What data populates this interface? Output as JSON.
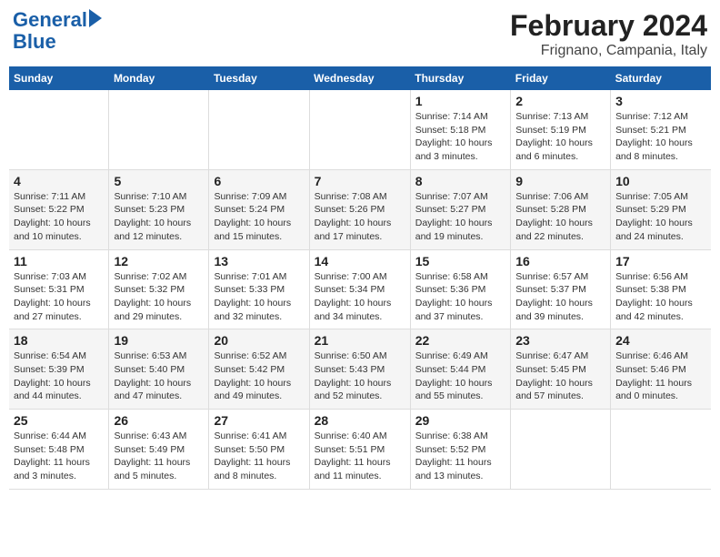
{
  "logo": {
    "line1": "General",
    "line2": "Blue"
  },
  "title": "February 2024",
  "subtitle": "Frignano, Campania, Italy",
  "headers": [
    "Sunday",
    "Monday",
    "Tuesday",
    "Wednesday",
    "Thursday",
    "Friday",
    "Saturday"
  ],
  "weeks": [
    [
      {
        "day": "",
        "info": ""
      },
      {
        "day": "",
        "info": ""
      },
      {
        "day": "",
        "info": ""
      },
      {
        "day": "",
        "info": ""
      },
      {
        "day": "1",
        "info": "Sunrise: 7:14 AM\nSunset: 5:18 PM\nDaylight: 10 hours\nand 3 minutes."
      },
      {
        "day": "2",
        "info": "Sunrise: 7:13 AM\nSunset: 5:19 PM\nDaylight: 10 hours\nand 6 minutes."
      },
      {
        "day": "3",
        "info": "Sunrise: 7:12 AM\nSunset: 5:21 PM\nDaylight: 10 hours\nand 8 minutes."
      }
    ],
    [
      {
        "day": "4",
        "info": "Sunrise: 7:11 AM\nSunset: 5:22 PM\nDaylight: 10 hours\nand 10 minutes."
      },
      {
        "day": "5",
        "info": "Sunrise: 7:10 AM\nSunset: 5:23 PM\nDaylight: 10 hours\nand 12 minutes."
      },
      {
        "day": "6",
        "info": "Sunrise: 7:09 AM\nSunset: 5:24 PM\nDaylight: 10 hours\nand 15 minutes."
      },
      {
        "day": "7",
        "info": "Sunrise: 7:08 AM\nSunset: 5:26 PM\nDaylight: 10 hours\nand 17 minutes."
      },
      {
        "day": "8",
        "info": "Sunrise: 7:07 AM\nSunset: 5:27 PM\nDaylight: 10 hours\nand 19 minutes."
      },
      {
        "day": "9",
        "info": "Sunrise: 7:06 AM\nSunset: 5:28 PM\nDaylight: 10 hours\nand 22 minutes."
      },
      {
        "day": "10",
        "info": "Sunrise: 7:05 AM\nSunset: 5:29 PM\nDaylight: 10 hours\nand 24 minutes."
      }
    ],
    [
      {
        "day": "11",
        "info": "Sunrise: 7:03 AM\nSunset: 5:31 PM\nDaylight: 10 hours\nand 27 minutes."
      },
      {
        "day": "12",
        "info": "Sunrise: 7:02 AM\nSunset: 5:32 PM\nDaylight: 10 hours\nand 29 minutes."
      },
      {
        "day": "13",
        "info": "Sunrise: 7:01 AM\nSunset: 5:33 PM\nDaylight: 10 hours\nand 32 minutes."
      },
      {
        "day": "14",
        "info": "Sunrise: 7:00 AM\nSunset: 5:34 PM\nDaylight: 10 hours\nand 34 minutes."
      },
      {
        "day": "15",
        "info": "Sunrise: 6:58 AM\nSunset: 5:36 PM\nDaylight: 10 hours\nand 37 minutes."
      },
      {
        "day": "16",
        "info": "Sunrise: 6:57 AM\nSunset: 5:37 PM\nDaylight: 10 hours\nand 39 minutes."
      },
      {
        "day": "17",
        "info": "Sunrise: 6:56 AM\nSunset: 5:38 PM\nDaylight: 10 hours\nand 42 minutes."
      }
    ],
    [
      {
        "day": "18",
        "info": "Sunrise: 6:54 AM\nSunset: 5:39 PM\nDaylight: 10 hours\nand 44 minutes."
      },
      {
        "day": "19",
        "info": "Sunrise: 6:53 AM\nSunset: 5:40 PM\nDaylight: 10 hours\nand 47 minutes."
      },
      {
        "day": "20",
        "info": "Sunrise: 6:52 AM\nSunset: 5:42 PM\nDaylight: 10 hours\nand 49 minutes."
      },
      {
        "day": "21",
        "info": "Sunrise: 6:50 AM\nSunset: 5:43 PM\nDaylight: 10 hours\nand 52 minutes."
      },
      {
        "day": "22",
        "info": "Sunrise: 6:49 AM\nSunset: 5:44 PM\nDaylight: 10 hours\nand 55 minutes."
      },
      {
        "day": "23",
        "info": "Sunrise: 6:47 AM\nSunset: 5:45 PM\nDaylight: 10 hours\nand 57 minutes."
      },
      {
        "day": "24",
        "info": "Sunrise: 6:46 AM\nSunset: 5:46 PM\nDaylight: 11 hours\nand 0 minutes."
      }
    ],
    [
      {
        "day": "25",
        "info": "Sunrise: 6:44 AM\nSunset: 5:48 PM\nDaylight: 11 hours\nand 3 minutes."
      },
      {
        "day": "26",
        "info": "Sunrise: 6:43 AM\nSunset: 5:49 PM\nDaylight: 11 hours\nand 5 minutes."
      },
      {
        "day": "27",
        "info": "Sunrise: 6:41 AM\nSunset: 5:50 PM\nDaylight: 11 hours\nand 8 minutes."
      },
      {
        "day": "28",
        "info": "Sunrise: 6:40 AM\nSunset: 5:51 PM\nDaylight: 11 hours\nand 11 minutes."
      },
      {
        "day": "29",
        "info": "Sunrise: 6:38 AM\nSunset: 5:52 PM\nDaylight: 11 hours\nand 13 minutes."
      },
      {
        "day": "",
        "info": ""
      },
      {
        "day": "",
        "info": ""
      }
    ]
  ]
}
